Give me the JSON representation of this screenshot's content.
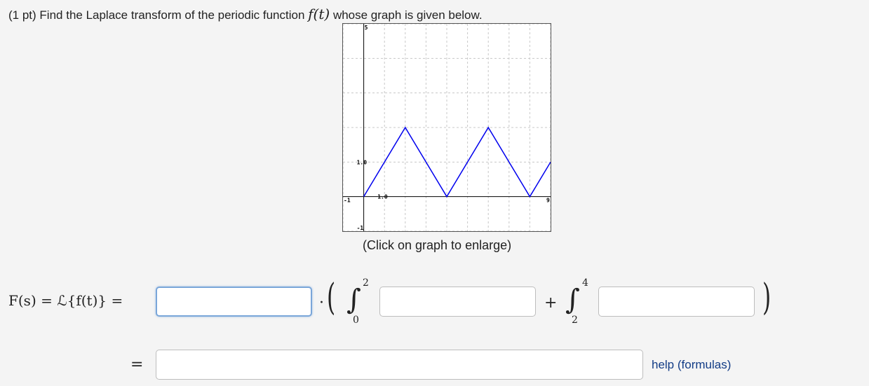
{
  "problem": {
    "points": "(1 pt)",
    "text_before": "Find the Laplace transform of the periodic function",
    "function_name": "f(t)",
    "text_after": "whose graph is given below."
  },
  "graph": {
    "caption": "(Click on graph to enlarge)",
    "tick_labels": {
      "y_top": "5",
      "y_mid": "1.0",
      "y_bottom": "-1",
      "x_left": "-1",
      "x_mid": "1.0",
      "x_right": "9"
    },
    "line_color": "#0000ee",
    "chart_data": {
      "type": "line",
      "xlim": [
        -1,
        9
      ],
      "ylim": [
        -1,
        5
      ],
      "grid": true,
      "series": [
        {
          "x": [
            0,
            2,
            4,
            6,
            8,
            9
          ],
          "y": [
            0,
            2,
            0,
            2,
            0,
            1
          ]
        }
      ]
    }
  },
  "equation": {
    "lhs": "F(s) = ℒ{f(t)} =",
    "dot": "·",
    "plus": "+",
    "equals": "=",
    "integral1": {
      "lower": "0",
      "upper": "2"
    },
    "integral2": {
      "lower": "2",
      "upper": "4"
    },
    "input1_value": "",
    "input2_value": "",
    "input3_value": "",
    "input4_value": ""
  },
  "help": {
    "label": "help (formulas)"
  }
}
